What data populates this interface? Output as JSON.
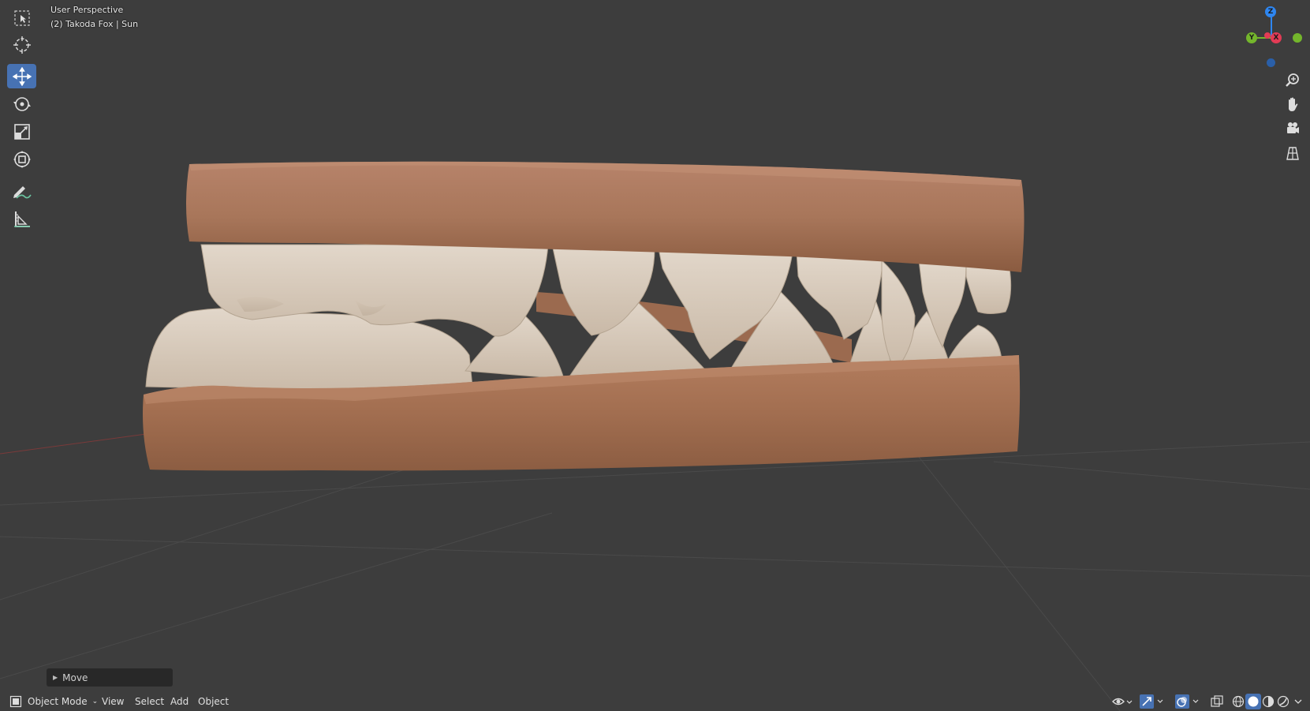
{
  "viewport": {
    "perspective_label": "User Perspective",
    "object_label": "(2) Takoda Fox | Sun"
  },
  "toolbar": {
    "tools": [
      {
        "name": "select-box",
        "active": false
      },
      {
        "name": "cursor",
        "active": false
      },
      {
        "name": "move",
        "active": true
      },
      {
        "name": "rotate",
        "active": false
      },
      {
        "name": "scale",
        "active": false
      },
      {
        "name": "transform",
        "active": false
      },
      {
        "name": "annotate",
        "active": false
      },
      {
        "name": "measure",
        "active": false
      }
    ]
  },
  "gizmo": {
    "z_label": "Z",
    "y_label": "Y",
    "x_label": "X",
    "colors": {
      "x": "#e23b55",
      "y": "#74b62c",
      "z": "#2e86f0"
    }
  },
  "operator_panel": {
    "label": "Move"
  },
  "header": {
    "mode_label": "Object Mode",
    "menu": [
      "View",
      "Select",
      "Add",
      "Object"
    ]
  },
  "colors": {
    "background": "#3d3d3d",
    "gum": "#a5704f",
    "teeth": "#d8cbbb",
    "accent": "#4772b3"
  }
}
